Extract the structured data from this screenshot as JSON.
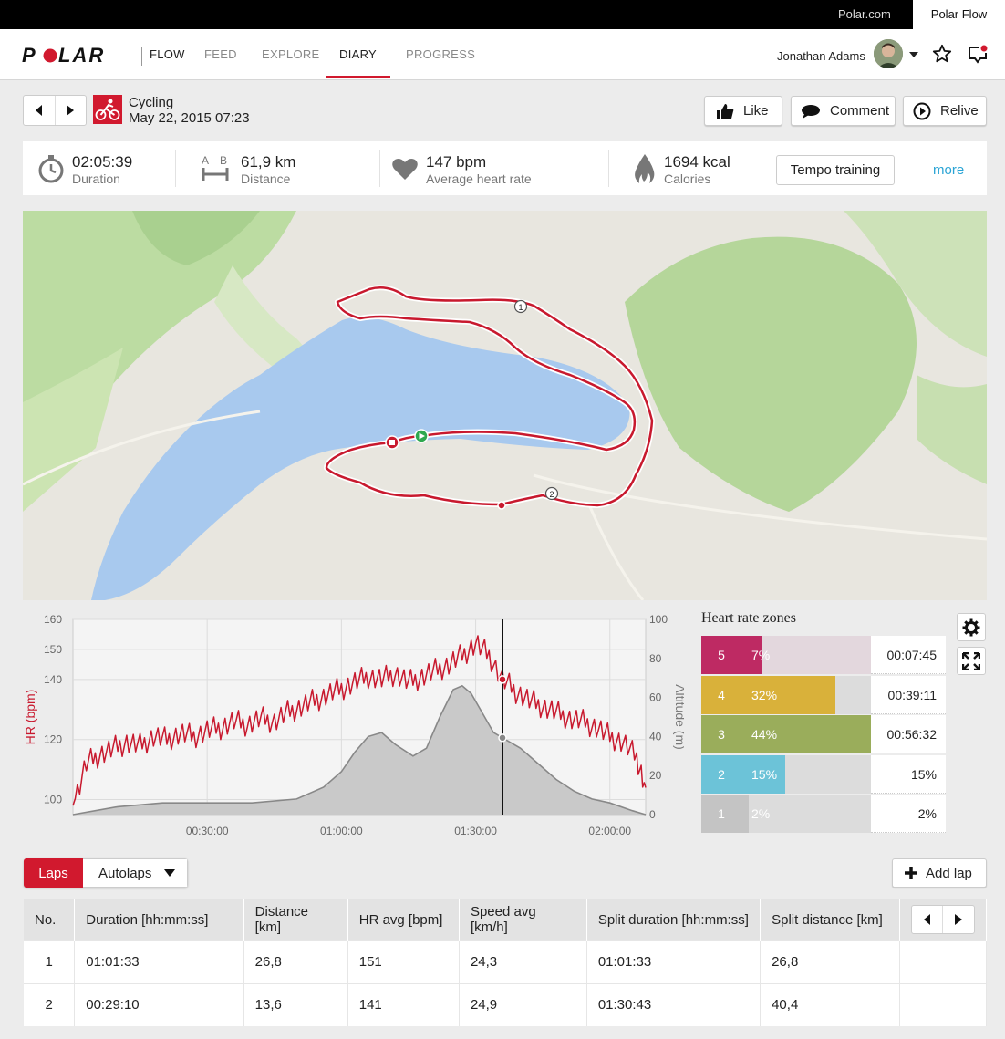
{
  "topbar": {
    "polar_com": "Polar.com",
    "polar_flow": "Polar Flow"
  },
  "nav": {
    "items": [
      {
        "label": "FLOW"
      },
      {
        "label": "FEED"
      },
      {
        "label": "EXPLORE"
      },
      {
        "label": "DIARY",
        "active": true
      },
      {
        "label": "PROGRESS"
      }
    ],
    "user_name": "Jonathan Adams"
  },
  "session": {
    "sport": "Cycling",
    "datetime": "May 22, 2015 07:23",
    "actions": {
      "like": "Like",
      "comment": "Comment",
      "relive": "Relive"
    }
  },
  "summary": {
    "duration": {
      "value": "02:05:39",
      "label": "Duration"
    },
    "distance": {
      "value": "61,9 km",
      "label": "Distance"
    },
    "heart_rate": {
      "value": "147 bpm",
      "label": "Average heart rate"
    },
    "calories": {
      "value": "1694 kcal",
      "label": "Calories"
    },
    "training_type": "Tempo training",
    "more": "more"
  },
  "map": {
    "markers": [
      "1",
      "2"
    ]
  },
  "chart_data": {
    "type": "line",
    "x_ticks": [
      "00:30:00",
      "01:00:00",
      "01:30:00",
      "02:00:00"
    ],
    "ylabel_left": "HR (bpm)",
    "ylabel_right": "Altitude (m)",
    "y_left_ticks": [
      100,
      120,
      140,
      150,
      160
    ],
    "y_right_ticks": [
      0,
      20,
      40,
      60,
      80,
      100
    ],
    "ylim_left": [
      95,
      160
    ],
    "ylim_right": [
      0,
      100
    ],
    "xlim_min": [
      0,
      128
    ],
    "series": [
      {
        "key": "hr",
        "color": "#c8192e",
        "x": [
          0,
          3,
          6,
          9,
          12,
          15,
          18,
          21,
          24,
          27,
          30,
          33,
          36,
          39,
          42,
          45,
          48,
          51,
          54,
          57,
          60,
          63,
          66,
          69,
          72,
          75,
          78,
          81,
          84,
          87,
          90,
          93,
          96,
          99,
          102,
          105,
          108,
          111,
          114,
          117,
          120,
          123,
          126,
          128
        ],
        "values": [
          98,
          112,
          115,
          117,
          119,
          118,
          121,
          120,
          122,
          121,
          123,
          124,
          126,
          125,
          127,
          126,
          129,
          131,
          133,
          135,
          137,
          139,
          141,
          140,
          142,
          139,
          141,
          143,
          145,
          148,
          152,
          148,
          140,
          136,
          133,
          131,
          129,
          127,
          126,
          124,
          121,
          119,
          114,
          104
        ]
      },
      {
        "key": "altitude",
        "color": "#888888",
        "x": [
          0,
          10,
          20,
          30,
          40,
          50,
          56,
          60,
          63,
          66,
          69,
          72,
          76,
          79,
          82,
          85,
          87,
          89,
          91,
          94,
          97,
          100,
          104,
          108,
          112,
          116,
          120,
          125,
          128
        ],
        "values": [
          0,
          4,
          6,
          6,
          6,
          8,
          14,
          22,
          32,
          40,
          42,
          36,
          30,
          34,
          50,
          64,
          66,
          62,
          54,
          42,
          38,
          34,
          26,
          18,
          12,
          8,
          6,
          2,
          0
        ]
      }
    ],
    "cursor_x": 96
  },
  "zones": {
    "title": "Heart rate zones",
    "rows": [
      {
        "zone": "5",
        "pct": "7%",
        "fraction": 0.07,
        "time": "00:07:45",
        "color": "#be2a63",
        "track": "#e3d7dd"
      },
      {
        "zone": "4",
        "pct": "32%",
        "fraction": 0.32,
        "time": "00:39:11",
        "color": "#d9b13a",
        "track": "#dcdcdc"
      },
      {
        "zone": "3",
        "pct": "44%",
        "fraction": 0.44,
        "time": "00:56:32",
        "color": "#9aad5b",
        "track": "#dcdcdc"
      },
      {
        "zone": "2",
        "pct": "15%",
        "fraction": 0.15,
        "time": "15%",
        "color": "#6cc3d8",
        "track": "#dcdcdc"
      },
      {
        "zone": "1",
        "pct": "2%",
        "fraction": 0.02,
        "time": "2%",
        "color": "#c4c4c4",
        "track": "#dcdcdc"
      }
    ]
  },
  "laps": {
    "tab_laps": "Laps",
    "tab_autolaps": "Autolaps",
    "add_lap": "Add lap",
    "columns": [
      "No.",
      "Duration [hh:mm:ss]",
      "Distance [km]",
      "HR avg [bpm]",
      "Speed avg [km/h]",
      "Split duration [hh:mm:ss]",
      "Split distance [km]"
    ],
    "rows": [
      [
        "1",
        "01:01:33",
        "26,8",
        "151",
        "24,3",
        "01:01:33",
        "26,8"
      ],
      [
        "2",
        "00:29:10",
        "13,6",
        "141",
        "24,9",
        "01:30:43",
        "40,4"
      ]
    ]
  },
  "colors": {
    "brand": "#d1192e",
    "link": "#2aa4d5"
  }
}
